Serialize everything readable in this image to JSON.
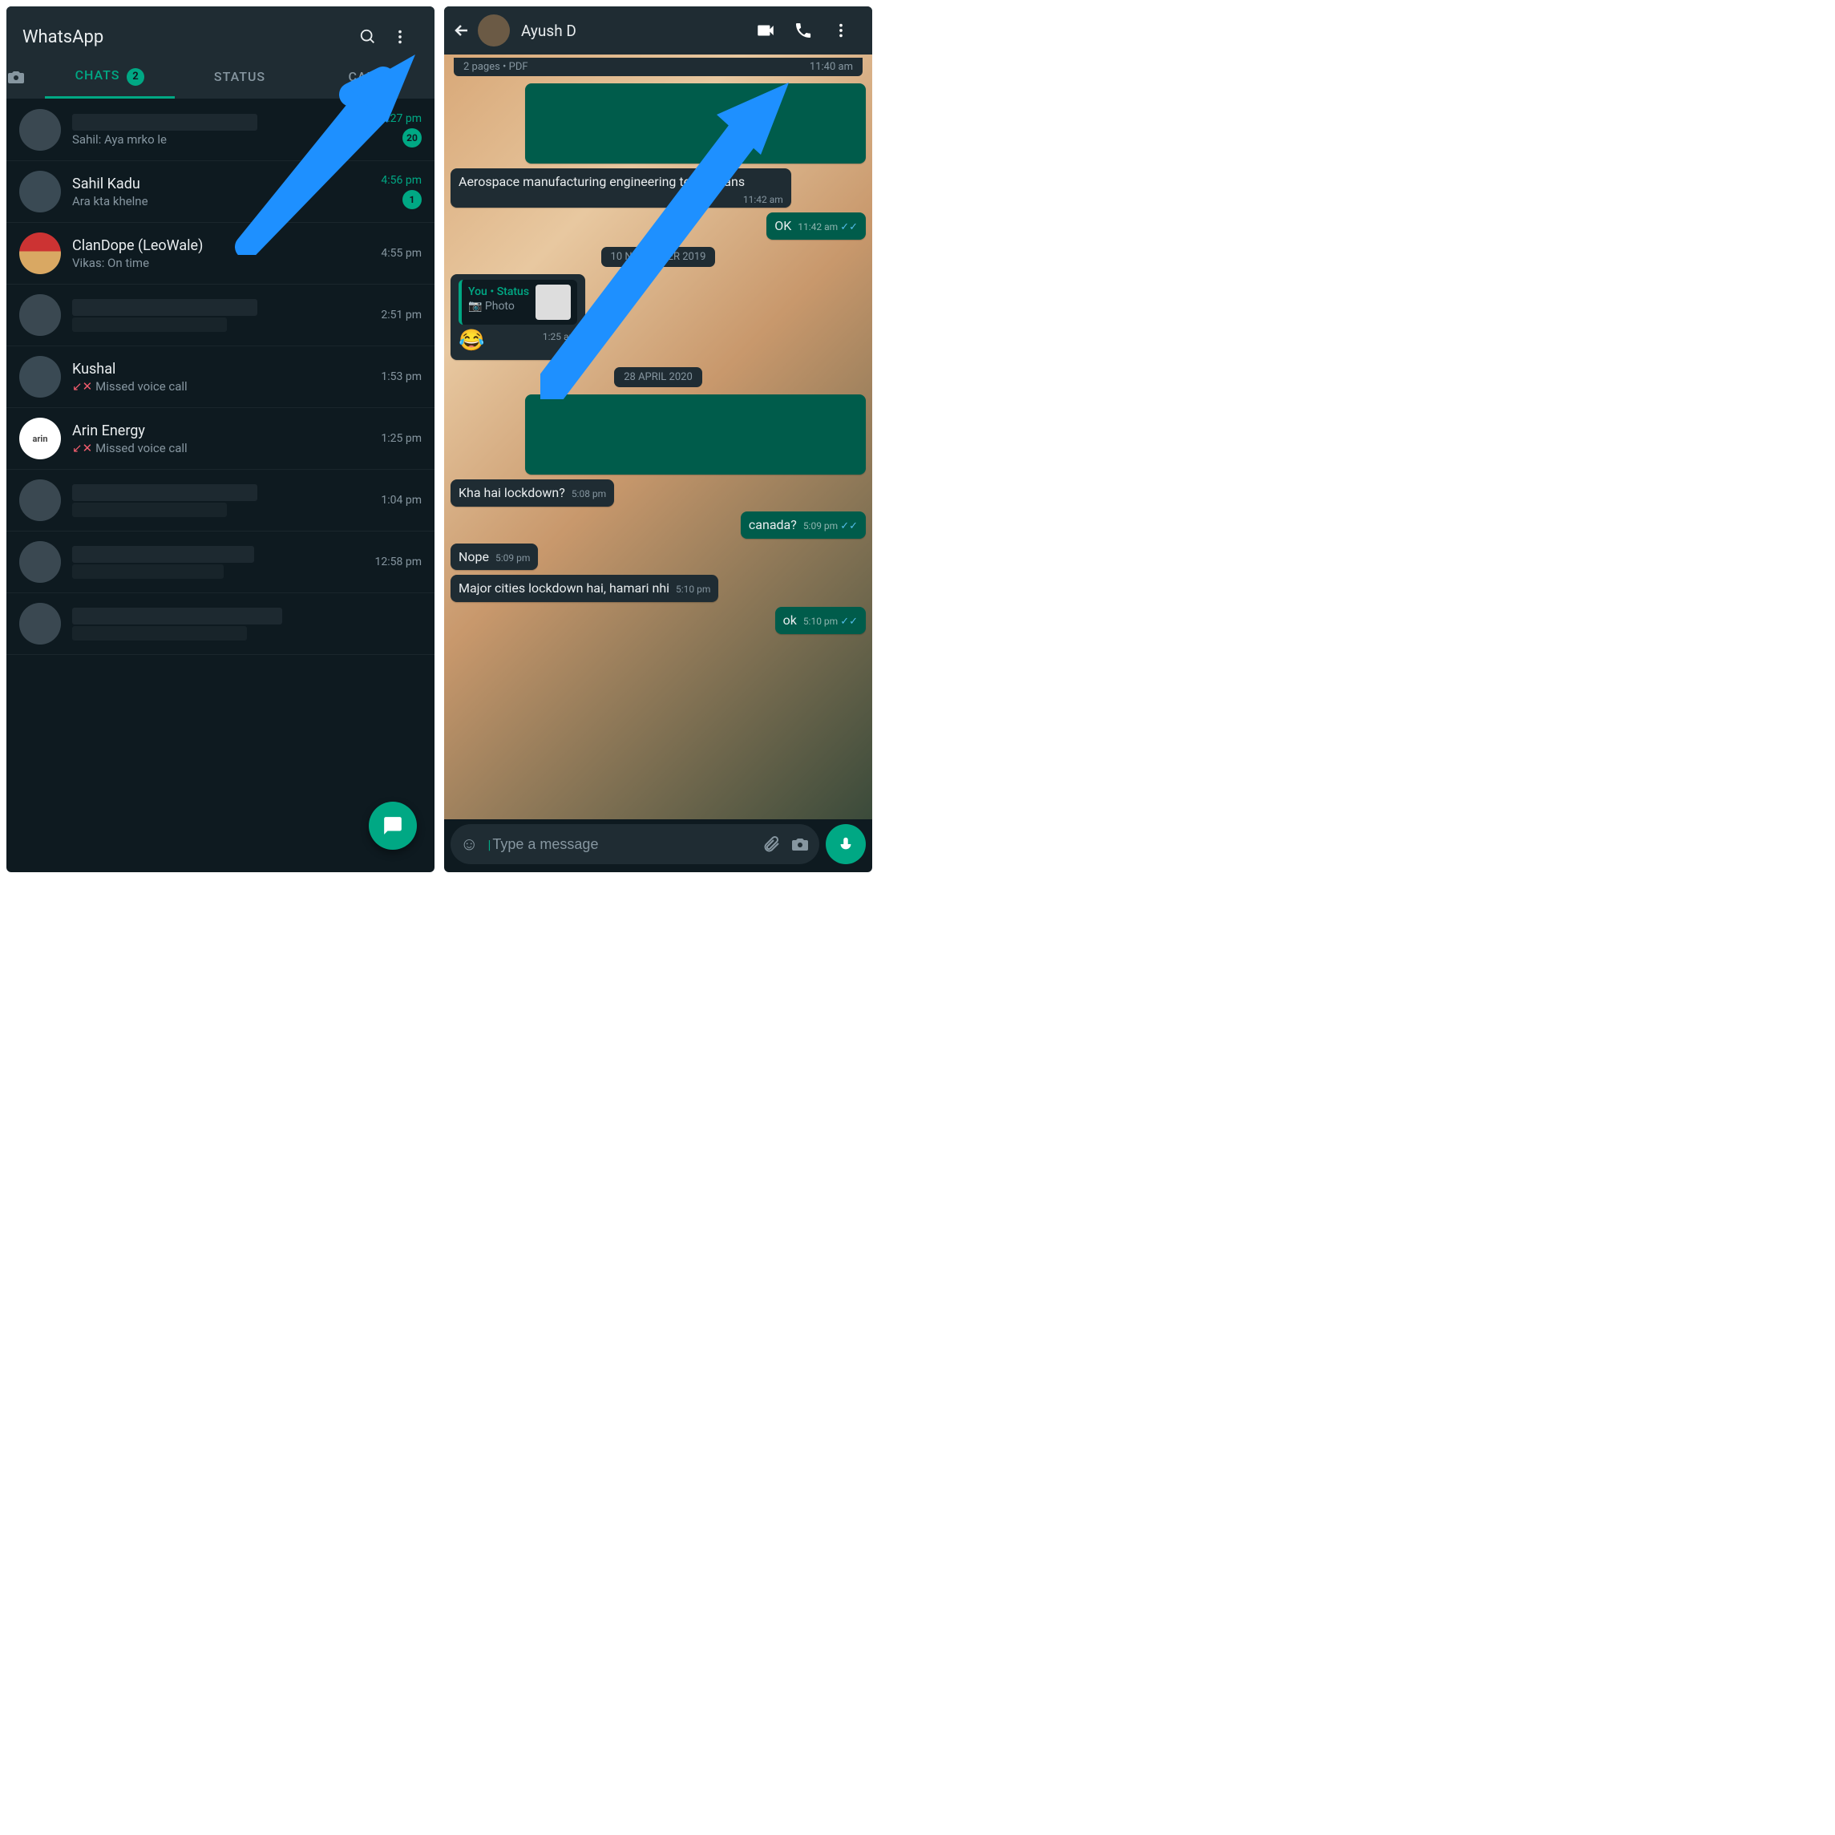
{
  "left": {
    "title": "WhatsApp",
    "tabs": {
      "chats": "CHATS",
      "chats_badge": "2",
      "status": "STATUS",
      "calls": "CALLS"
    },
    "chats": [
      {
        "name": "",
        "preview": "Sahil: Aya mrko le",
        "time": "5:27 pm",
        "unread": "20",
        "blurName": true
      },
      {
        "name": "Sahil Kadu",
        "preview": "Ara kta khelne",
        "time": "4:56 pm",
        "unread": "1"
      },
      {
        "name": "ClanDope (LeoWale)",
        "preview": "Vikas: On time",
        "time": "4:55 pm"
      },
      {
        "name": "",
        "preview": "",
        "time": "2:51 pm",
        "blurName": true,
        "blurPreview": true
      },
      {
        "name": "Kushal",
        "preview": "Missed voice call",
        "time": "1:53 pm",
        "missed": true
      },
      {
        "name": "Arin Energy",
        "preview": "Missed voice call",
        "time": "1:25 pm",
        "missed": true,
        "whiteAv": true,
        "avText": "arin"
      },
      {
        "name": "",
        "preview": "",
        "time": "1:04 pm",
        "blurName": true,
        "blurPreview": true
      },
      {
        "name": "",
        "preview": "",
        "time": "12:58 pm",
        "blurName": true,
        "blurPreview": true
      },
      {
        "name": "",
        "preview": "",
        "time": "",
        "blurName": true,
        "blurPreview": true
      }
    ]
  },
  "right": {
    "contact": "Ayush D",
    "doc_meta": "2 pages  •  PDF",
    "doc_time": "11:40 am",
    "dates": {
      "d1": "10 NOVEMBER 2019",
      "d2": "28 APRIL 2020"
    },
    "messages": {
      "m1": "Aerospace manufacturing engineering technicians",
      "m1_time": "11:42 am",
      "m2": "OK",
      "m2_time": "11:42 am",
      "reply_who": "You  •  Status",
      "reply_what": "Photo",
      "m3_emoji": "😂",
      "m3_time": "1:25 am",
      "m4": "Kha hai lockdown?",
      "m4_time": "5:08 pm",
      "m5": "canada?",
      "m5_time": "5:09 pm",
      "m6": "Nope",
      "m6_time": "5:09 pm",
      "m7": "Major cities lockdown hai, hamari nhi",
      "m7_time": "5:10 pm",
      "m8": "ok",
      "m8_time": "5:10 pm"
    },
    "input_placeholder": "Type a message"
  }
}
